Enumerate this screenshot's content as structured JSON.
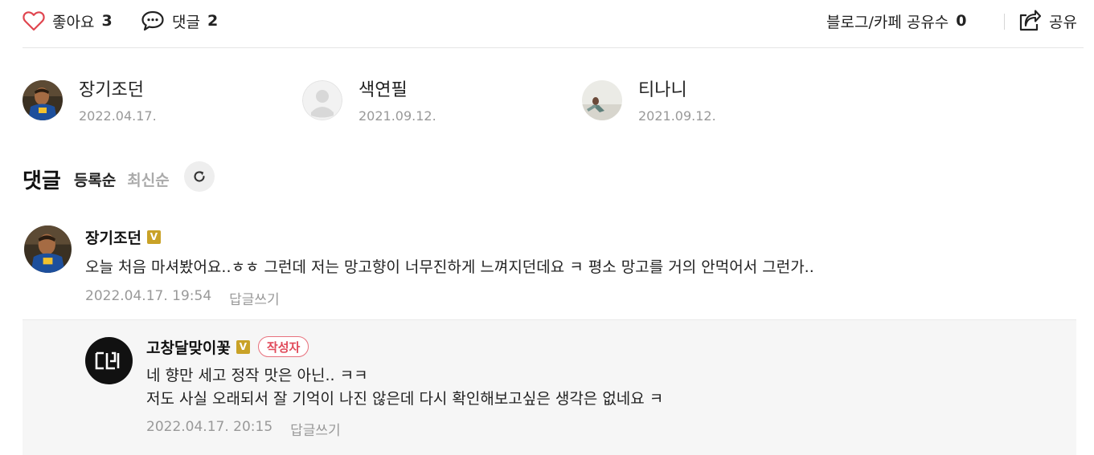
{
  "topbar": {
    "like_label": "좋아요",
    "like_count": "3",
    "comment_label": "댓글",
    "comment_count": "2",
    "share_count_label": "블로그/카페 공유수",
    "share_count": "0",
    "share_label": "공유"
  },
  "likers": [
    {
      "name": "장기조던",
      "date": "2022.04.17."
    },
    {
      "name": "색연필",
      "date": "2021.09.12."
    },
    {
      "name": "티나니",
      "date": "2021.09.12."
    }
  ],
  "comments_header": {
    "title": "댓글",
    "sort_registered": "등록순",
    "sort_latest": "최신순"
  },
  "comment": {
    "author": "장기조던",
    "badge": "V",
    "text": "오늘 처음 마셔봤어요..ㅎㅎ 그런데 저는 망고향이 너무진하게 느껴지던데요 ㅋ 평소 망고를 거의 안먹어서 그런가..",
    "time": "2022.04.17. 19:54",
    "reply_label": "답글쓰기"
  },
  "reply": {
    "author": "고창달맞이꽃",
    "badge": "V",
    "author_tag": "작성자",
    "line1": "네 향만 세고 정작 맛은 아닌.. ㅋㅋ",
    "line2": "저도 사실 오래되서 잘 기억이 나진 않은데 다시 확인해보고싶은 생각은 없네요 ㅋ",
    "time": "2022.04.17. 20:15",
    "reply_label": "답글쓰기"
  },
  "colors": {
    "heart": "#e0454f",
    "badge": "#c9a227",
    "author_tag": "#e04a5a",
    "reply_bg": "#f6f6f6"
  }
}
